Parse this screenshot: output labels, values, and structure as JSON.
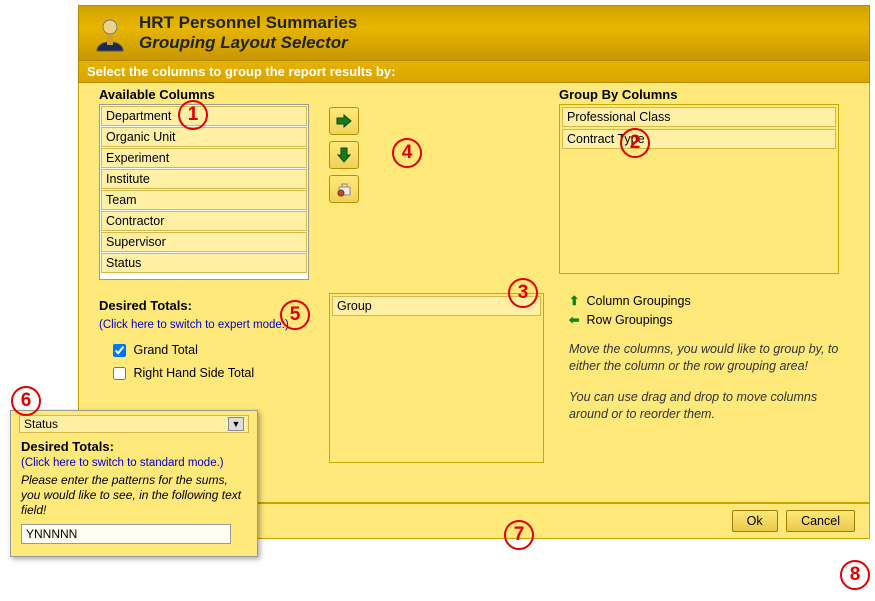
{
  "title": {
    "line1": "HRT Personnel Summaries",
    "line2": "Grouping Layout Selector"
  },
  "subheader": "Select the columns to group the report results by:",
  "available": {
    "title": "Available Columns",
    "items": [
      "Department",
      "Organic Unit",
      "Experiment",
      "Institute",
      "Team",
      "Contractor",
      "Supervisor",
      "Status"
    ]
  },
  "buttons": {
    "add": "➪",
    "down": "⬇",
    "cancel_small": "✋"
  },
  "groupby": {
    "title": "Group By Columns",
    "items": [
      "Professional Class",
      "Contract Type"
    ]
  },
  "groupbox": {
    "items": [
      "Group"
    ]
  },
  "totals": {
    "title": "Desired Totals:",
    "expert_link": "(Click here to switch to expert mode.)",
    "grand_label": "Grand Total",
    "grand_checked": true,
    "rhs_label": "Right Hand Side Total",
    "rhs_checked": false
  },
  "legend": {
    "col_label": "Column Groupings",
    "row_label": "Row Groupings",
    "hint1": "Move the columns, you would like to group by, to either the column or the row grouping area!",
    "hint2": "You can use drag and drop to move columns around or to reorder them."
  },
  "footer": {
    "ok": "Ok",
    "cancel": "Cancel"
  },
  "expert": {
    "row1": "Status",
    "dtitle": "Desired Totals:",
    "stdlink": "(Click here to switch to standard mode.)",
    "instr": "Please enter the patterns for the sums, you would like to see, in the following text field!",
    "value": "YNNNNN"
  },
  "callouts": [
    "1",
    "2",
    "3",
    "4",
    "5",
    "6",
    "7",
    "8"
  ]
}
